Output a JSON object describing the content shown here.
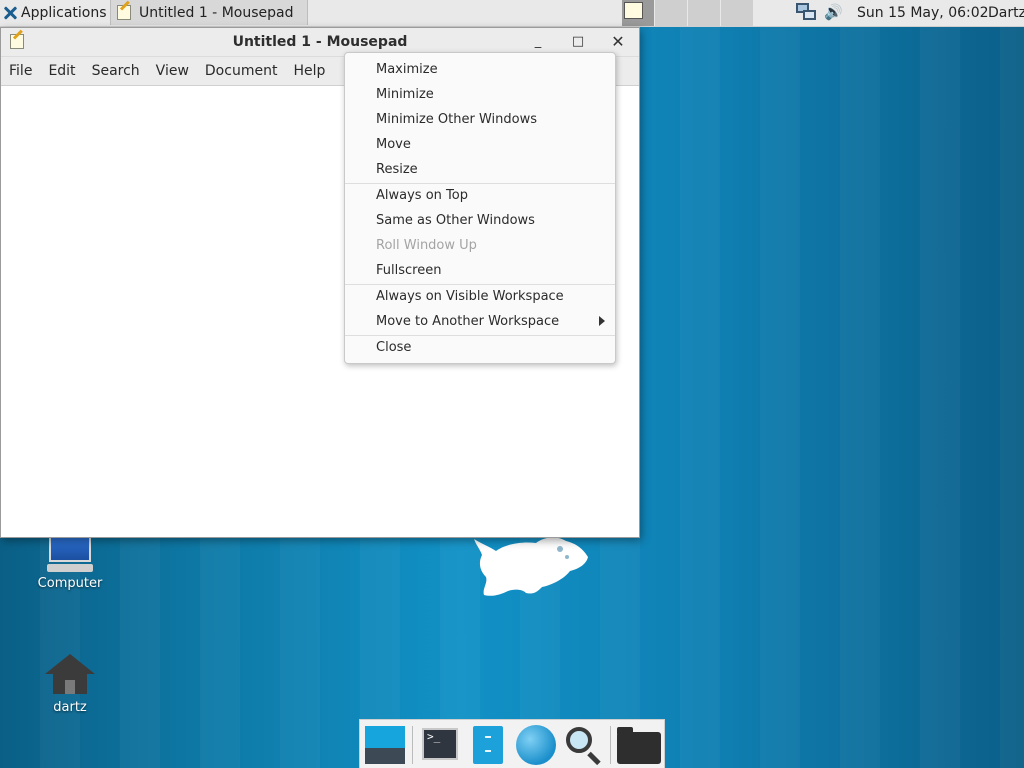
{
  "top_panel": {
    "applications_label": "Applications",
    "task_title": "Untitled 1 - Mousepad",
    "clock": "Sun 15 May, 06:02",
    "user": "Dartz",
    "volume_glyph": "🔊"
  },
  "window": {
    "title": "Untitled 1 - Mousepad",
    "minimize_glyph": "_",
    "maximize_glyph": "□",
    "close_glyph": "✕",
    "menu": [
      "File",
      "Edit",
      "Search",
      "View",
      "Document",
      "Help"
    ],
    "editor_text": ""
  },
  "context_menu": {
    "items": [
      {
        "label": "Maximize",
        "enabled": true
      },
      {
        "label": "Minimize",
        "enabled": true
      },
      {
        "label": "Minimize Other Windows",
        "enabled": true
      },
      {
        "label": "Move",
        "enabled": true
      },
      {
        "label": "Resize",
        "enabled": true
      },
      {
        "label": "Always on Top",
        "enabled": true
      },
      {
        "label": "Same as Other Windows",
        "enabled": true
      },
      {
        "label": "Roll Window Up",
        "enabled": false
      },
      {
        "label": "Fullscreen",
        "enabled": true
      },
      {
        "label": "Always on Visible Workspace",
        "enabled": true
      },
      {
        "label": "Move to Another Workspace",
        "enabled": true,
        "submenu": true
      },
      {
        "label": "Close",
        "enabled": true
      }
    ]
  },
  "desktop": {
    "icons": [
      {
        "label": "Computer",
        "icon": "computer-icon"
      },
      {
        "label": "dartz",
        "icon": "home-folder-icon"
      }
    ]
  },
  "dock": {
    "items": [
      "show-desktop-icon",
      "terminal-icon",
      "file-manager-icon",
      "web-browser-icon",
      "app-finder-icon",
      "folder-icon"
    ],
    "terminal_prompt": ">_"
  },
  "colors": {
    "desktop_blue": "#1191c6",
    "panel_bg": "#e9e9e9",
    "menu_disabled": "#a4a4a4"
  }
}
